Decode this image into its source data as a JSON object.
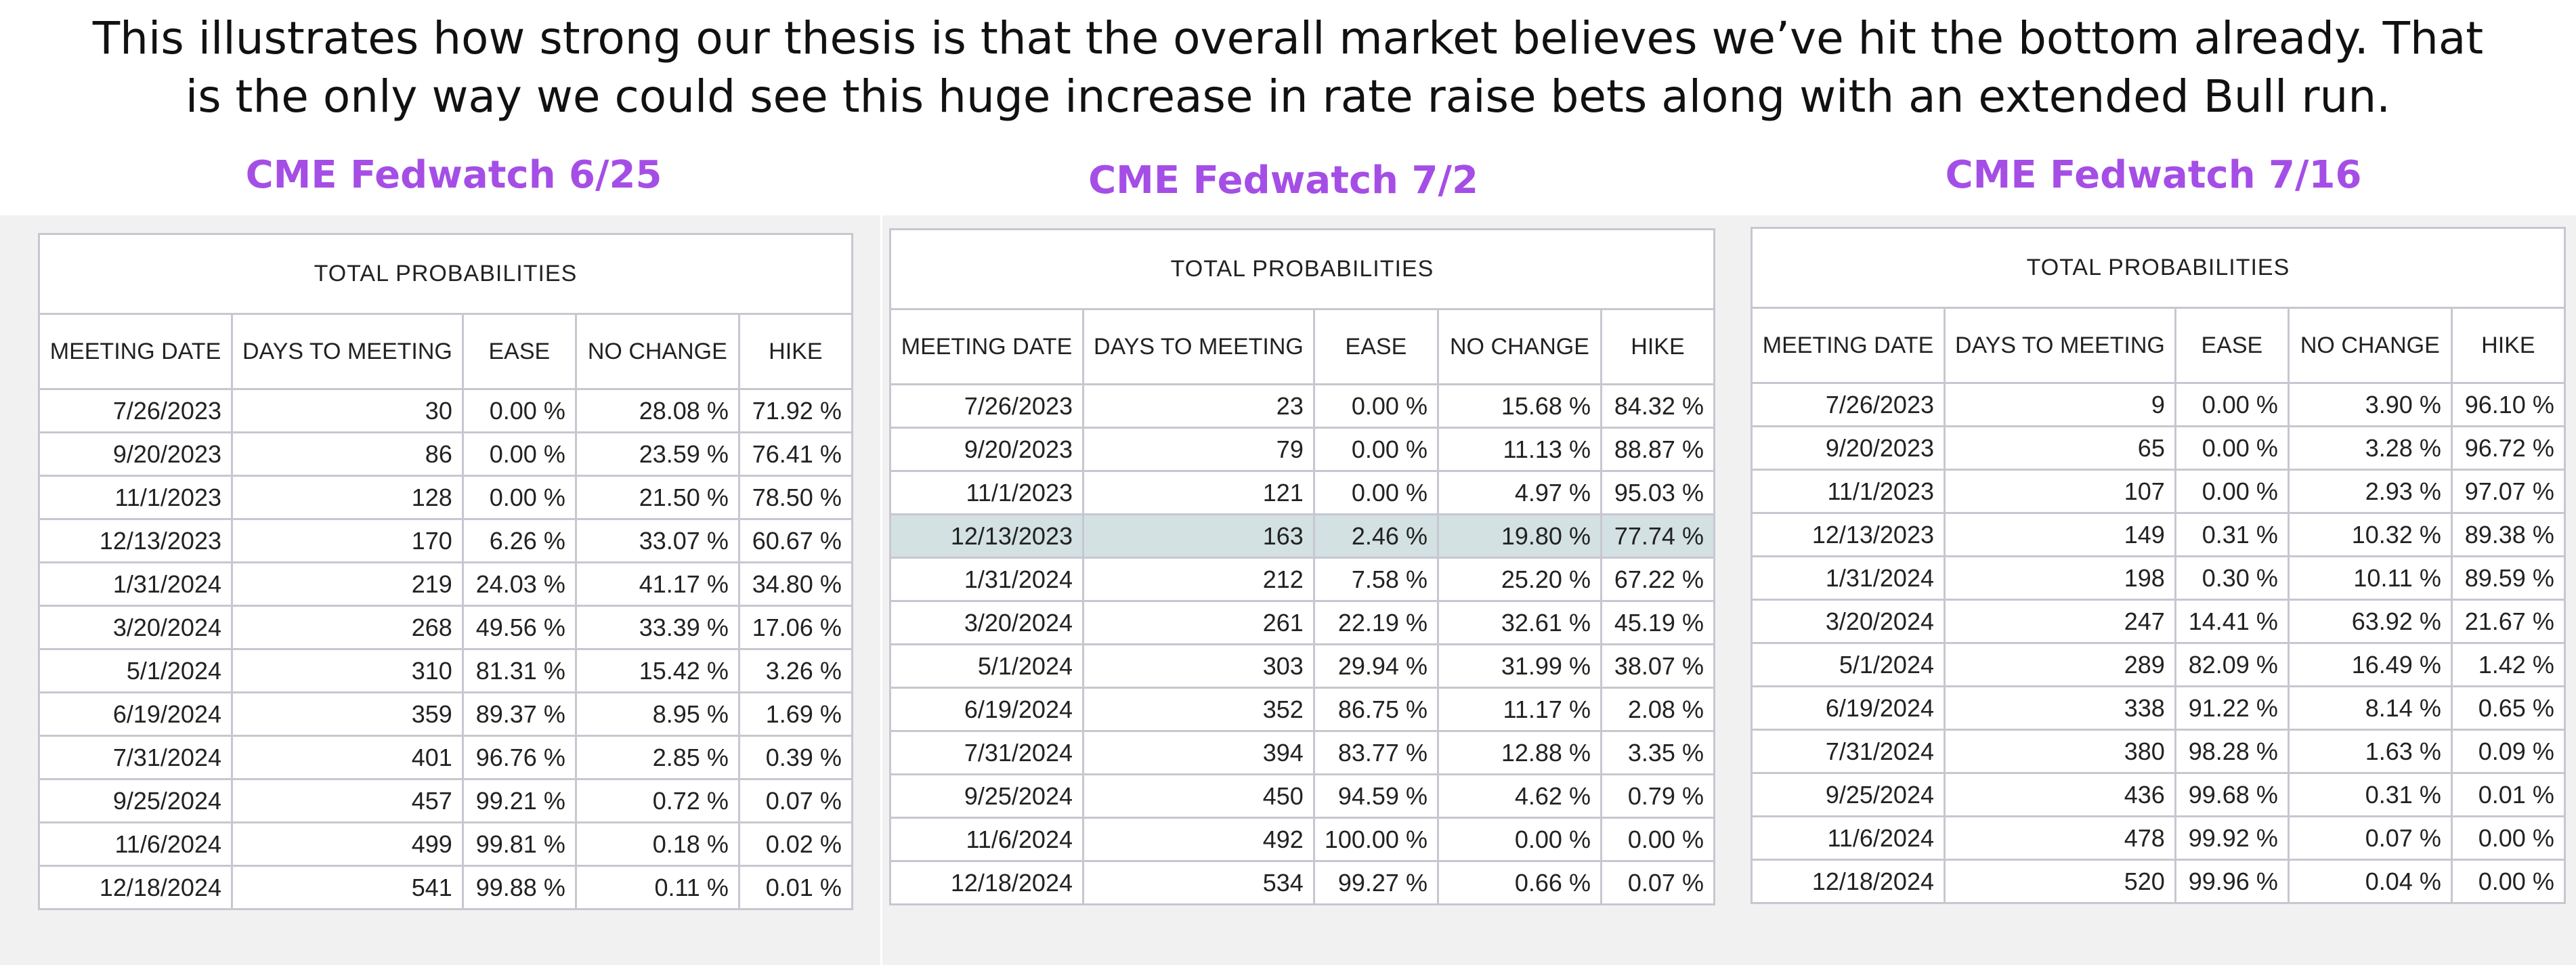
{
  "headline": {
    "line1": "This illustrates how strong our thesis is that the overall market believes we’ve hit the bottom already. That",
    "line2": "is the only way we could see this huge increase in rate raise bets along with an extended Bull run."
  },
  "colors": {
    "title": "#a54ee6",
    "highlight_row": "#d3e1e2",
    "grid": "#c7c7d1"
  },
  "columns": [
    "MEETING DATE",
    "DAYS TO MEETING",
    "EASE",
    "NO CHANGE",
    "HIKE"
  ],
  "table_caption": "TOTAL PROBABILITIES",
  "panels": [
    {
      "title": "CME Fedwatch 6/25",
      "rows": [
        [
          "7/26/2023",
          "30",
          "0.00 %",
          "28.08 %",
          "71.92 %"
        ],
        [
          "9/20/2023",
          "86",
          "0.00 %",
          "23.59 %",
          "76.41 %"
        ],
        [
          "11/1/2023",
          "128",
          "0.00 %",
          "21.50 %",
          "78.50 %"
        ],
        [
          "12/13/2023",
          "170",
          "6.26 %",
          "33.07 %",
          "60.67 %"
        ],
        [
          "1/31/2024",
          "219",
          "24.03 %",
          "41.17 %",
          "34.80 %"
        ],
        [
          "3/20/2024",
          "268",
          "49.56 %",
          "33.39 %",
          "17.06 %"
        ],
        [
          "5/1/2024",
          "310",
          "81.31 %",
          "15.42 %",
          "3.26 %"
        ],
        [
          "6/19/2024",
          "359",
          "89.37 %",
          "8.95 %",
          "1.69 %"
        ],
        [
          "7/31/2024",
          "401",
          "96.76 %",
          "2.85 %",
          "0.39 %"
        ],
        [
          "9/25/2024",
          "457",
          "99.21 %",
          "0.72 %",
          "0.07 %"
        ],
        [
          "11/6/2024",
          "499",
          "99.81 %",
          "0.18 %",
          "0.02 %"
        ],
        [
          "12/18/2024",
          "541",
          "99.88 %",
          "0.11 %",
          "0.01 %"
        ]
      ]
    },
    {
      "title": "CME Fedwatch 7/2",
      "rows": [
        [
          "7/26/2023",
          "23",
          "0.00 %",
          "15.68 %",
          "84.32 %"
        ],
        [
          "9/20/2023",
          "79",
          "0.00 %",
          "11.13 %",
          "88.87 %"
        ],
        [
          "11/1/2023",
          "121",
          "0.00 %",
          "4.97 %",
          "95.03 %"
        ],
        [
          "12/13/2023",
          "163",
          "2.46 %",
          "19.80 %",
          "77.74 %"
        ],
        [
          "1/31/2024",
          "212",
          "7.58 %",
          "25.20 %",
          "67.22 %"
        ],
        [
          "3/20/2024",
          "261",
          "22.19 %",
          "32.61 %",
          "45.19 %"
        ],
        [
          "5/1/2024",
          "303",
          "29.94 %",
          "31.99 %",
          "38.07 %"
        ],
        [
          "6/19/2024",
          "352",
          "86.75 %",
          "11.17 %",
          "2.08 %"
        ],
        [
          "7/31/2024",
          "394",
          "83.77 %",
          "12.88 %",
          "3.35 %"
        ],
        [
          "9/25/2024",
          "450",
          "94.59 %",
          "4.62 %",
          "0.79 %"
        ],
        [
          "11/6/2024",
          "492",
          "100.00 %",
          "0.00 %",
          "0.00 %"
        ],
        [
          "12/18/2024",
          "534",
          "99.27 %",
          "0.66 %",
          "0.07 %"
        ]
      ]
    },
    {
      "title": "CME Fedwatch 7/16",
      "rows": [
        [
          "7/26/2023",
          "9",
          "0.00 %",
          "3.90 %",
          "96.10 %"
        ],
        [
          "9/20/2023",
          "65",
          "0.00 %",
          "3.28 %",
          "96.72 %"
        ],
        [
          "11/1/2023",
          "107",
          "0.00 %",
          "2.93 %",
          "97.07 %"
        ],
        [
          "12/13/2023",
          "149",
          "0.31 %",
          "10.32 %",
          "89.38 %"
        ],
        [
          "1/31/2024",
          "198",
          "0.30 %",
          "10.11 %",
          "89.59 %"
        ],
        [
          "3/20/2024",
          "247",
          "14.41 %",
          "63.92 %",
          "21.67 %"
        ],
        [
          "5/1/2024",
          "289",
          "82.09 %",
          "16.49 %",
          "1.42 %"
        ],
        [
          "6/19/2024",
          "338",
          "91.22 %",
          "8.14 %",
          "0.65 %"
        ],
        [
          "7/31/2024",
          "380",
          "98.28 %",
          "1.63 %",
          "0.09 %"
        ],
        [
          "9/25/2024",
          "436",
          "99.68 %",
          "0.31 %",
          "0.01 %"
        ],
        [
          "11/6/2024",
          "478",
          "99.92 %",
          "0.07 %",
          "0.00 %"
        ],
        [
          "12/18/2024",
          "520",
          "99.96 %",
          "0.04 %",
          "0.00 %"
        ]
      ]
    }
  ]
}
